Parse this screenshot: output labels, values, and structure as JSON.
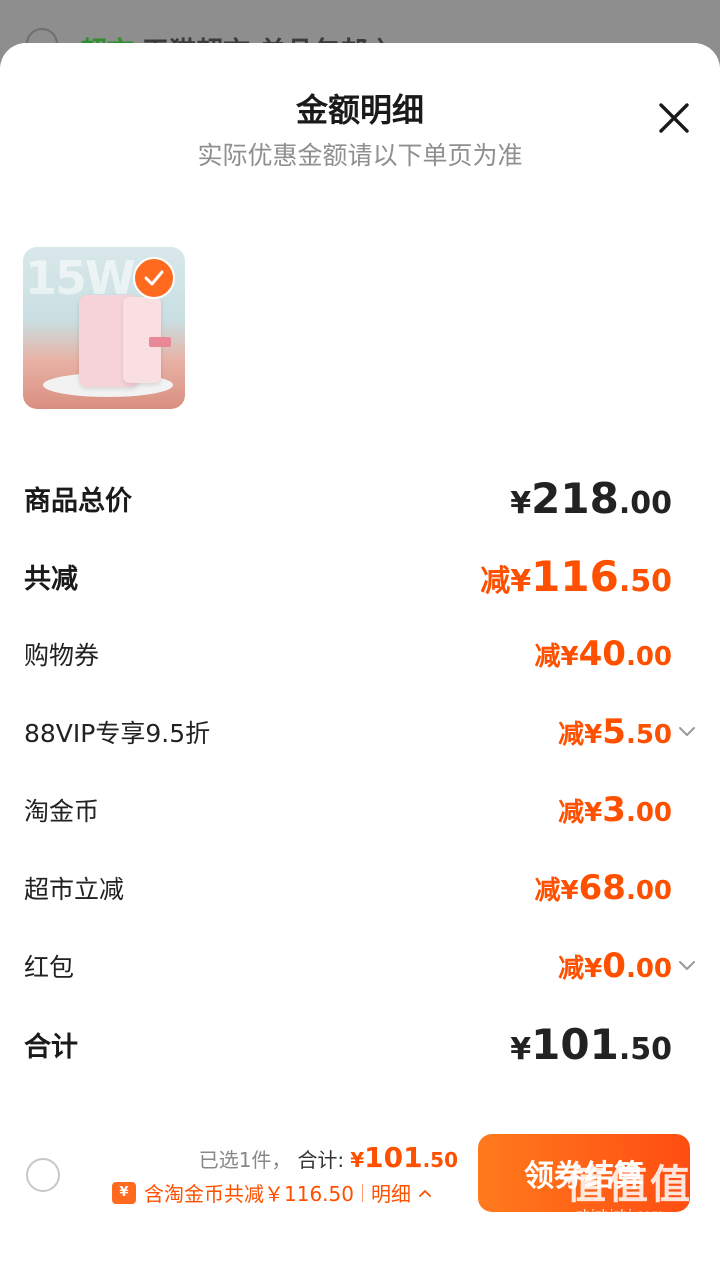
{
  "background": {
    "tag": "超市",
    "text": "天猫超市 单品包邮 〉"
  },
  "sheet": {
    "title": "金额明细",
    "subtitle": "实际优惠金额请以下单页为准"
  },
  "product": {
    "selected": true
  },
  "rows": [
    {
      "label": "商品总价",
      "prefix": "¥",
      "int": "218",
      "dec": ".00"
    },
    {
      "label": "共减",
      "prefix": "减¥",
      "int": "116",
      "dec": ".50"
    },
    {
      "label": "购物券",
      "prefix": "减¥",
      "int": "40",
      "dec": ".00"
    },
    {
      "label": "88VIP专享9.5折",
      "prefix": "减¥",
      "int": "5",
      "dec": ".50"
    },
    {
      "label": "淘金币",
      "prefix": "减¥",
      "int": "3",
      "dec": ".00"
    },
    {
      "label": "超市立减",
      "prefix": "减¥",
      "int": "68",
      "dec": ".00"
    },
    {
      "label": "红包",
      "prefix": "减¥",
      "int": "0",
      "dec": ".00"
    },
    {
      "label": "合计",
      "prefix": "¥",
      "int": "101",
      "dec": ".50"
    }
  ],
  "bottom": {
    "selected_text": "已选1件，",
    "total_label": "合计:",
    "total_prefix": "¥",
    "total_int": "101",
    "total_dec": ".50",
    "coin_badge": "¥",
    "coin_text": "含淘金币共减￥116.50",
    "detail_link": "明细",
    "button_label": "领券结算"
  },
  "watermark": {
    "text": "值值值",
    "url": "zhizhizhi.com"
  },
  "colors": {
    "accent": "#ff5000",
    "button": "#ff6a1f"
  }
}
